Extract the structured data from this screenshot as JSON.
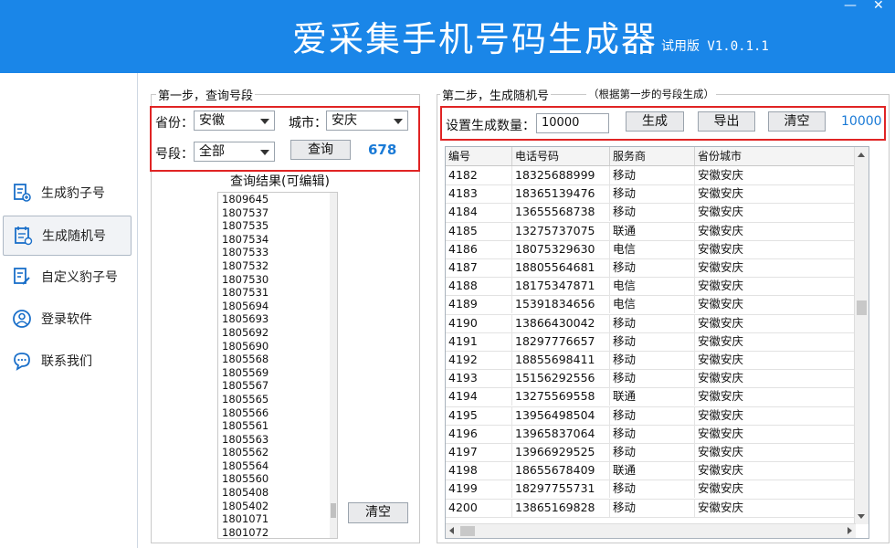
{
  "header": {
    "title": "爱采集手机号码生成器",
    "version": "试用版 V1.0.1.1",
    "minimize": "—",
    "close": "✕"
  },
  "sidebar": {
    "items": [
      {
        "label": "生成豹子号",
        "icon": "document-generate-icon"
      },
      {
        "label": "生成随机号",
        "icon": "calendar-list-icon",
        "active": true
      },
      {
        "label": "自定义豹子号",
        "icon": "edit-document-icon"
      },
      {
        "label": "登录软件",
        "icon": "user-icon"
      },
      {
        "label": "联系我们",
        "icon": "chat-bubble-icon"
      }
    ]
  },
  "step1": {
    "title": "第一步，查询号段",
    "province_label": "省份：",
    "province_value": "安徽",
    "city_label": "城市：",
    "city_value": "安庆",
    "segment_label": "号段：",
    "segment_value": "全部",
    "query_button": "查询",
    "count": "678",
    "result_title": "查询结果(可编辑)",
    "codes": [
      "1809645",
      "1807537",
      "1807535",
      "1807534",
      "1807533",
      "1807532",
      "1807530",
      "1807531",
      "1805694",
      "1805693",
      "1805692",
      "1805690",
      "1805568",
      "1805569",
      "1805567",
      "1805565",
      "1805566",
      "1805561",
      "1805563",
      "1805562",
      "1805564",
      "1805560",
      "1805408",
      "1805402",
      "1801071",
      "1801072"
    ],
    "clear_button": "清空"
  },
  "step2": {
    "title": "第二步，生成随机号",
    "note": "（根据第一步的号段生成）",
    "quantity_label": "设置生成数量：",
    "quantity_value": "10000",
    "generate_button": "生成",
    "export_button": "导出",
    "clear_button": "清空",
    "count": "10000",
    "columns": [
      "编号",
      "电话号码",
      "服务商",
      "省份城市"
    ],
    "rows": [
      [
        "4182",
        "18325688999",
        "移动",
        "安徽安庆"
      ],
      [
        "4183",
        "18365139476",
        "移动",
        "安徽安庆"
      ],
      [
        "4184",
        "13655568738",
        "移动",
        "安徽安庆"
      ],
      [
        "4185",
        "13275737075",
        "联通",
        "安徽安庆"
      ],
      [
        "4186",
        "18075329630",
        "电信",
        "安徽安庆"
      ],
      [
        "4187",
        "18805564681",
        "移动",
        "安徽安庆"
      ],
      [
        "4188",
        "18175347871",
        "电信",
        "安徽安庆"
      ],
      [
        "4189",
        "15391834656",
        "电信",
        "安徽安庆"
      ],
      [
        "4190",
        "13866430042",
        "移动",
        "安徽安庆"
      ],
      [
        "4191",
        "18297776657",
        "移动",
        "安徽安庆"
      ],
      [
        "4192",
        "18855698411",
        "移动",
        "安徽安庆"
      ],
      [
        "4193",
        "15156292556",
        "移动",
        "安徽安庆"
      ],
      [
        "4194",
        "13275569558",
        "联通",
        "安徽安庆"
      ],
      [
        "4195",
        "13956498504",
        "移动",
        "安徽安庆"
      ],
      [
        "4196",
        "13965837064",
        "移动",
        "安徽安庆"
      ],
      [
        "4197",
        "13966929525",
        "移动",
        "安徽安庆"
      ],
      [
        "4198",
        "18655678409",
        "联通",
        "安徽安庆"
      ],
      [
        "4199",
        "18297755731",
        "移动",
        "安徽安庆"
      ],
      [
        "4200",
        "13865169828",
        "移动",
        "安徽安庆"
      ]
    ]
  },
  "colors": {
    "header_bg": "#1a86e8",
    "highlight_border": "#e02424",
    "count_text": "#1a7ad6"
  }
}
